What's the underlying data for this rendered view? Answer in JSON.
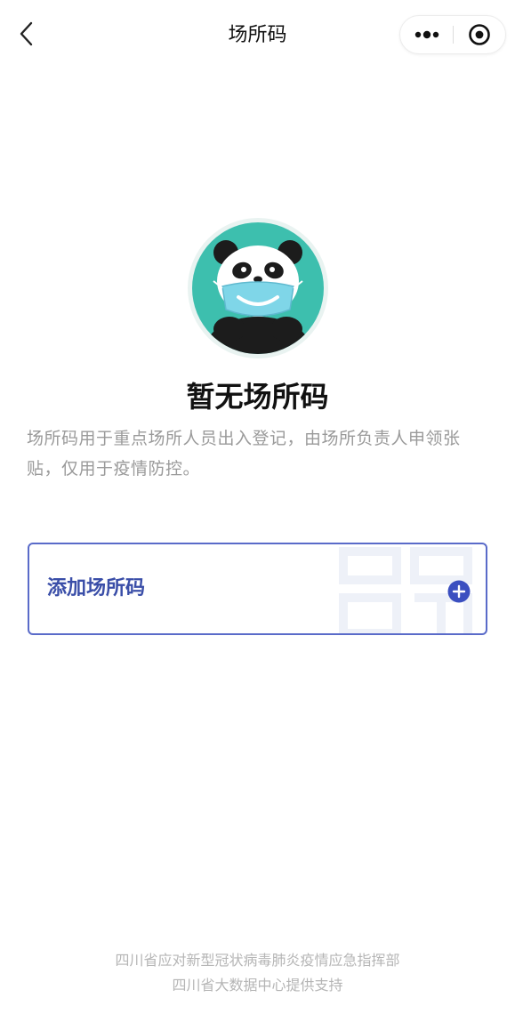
{
  "navbar": {
    "title": "场所码",
    "back_icon": "chevron-left-icon",
    "more_icon": "more-dots-icon",
    "close_icon": "target-close-icon"
  },
  "empty_state": {
    "mascot_icon": "masked-panda-icon",
    "title": "暂无场所码",
    "description": "场所码用于重点场所人员出入登记，由场所负责人申领张贴，仅用于疫情防控。"
  },
  "add_card": {
    "label": "添加场所码",
    "icon": "plus-circle-icon",
    "accent_color": "#3a4ea8"
  },
  "footer": {
    "line1": "四川省应对新型冠状病毒肺炎疫情应急指挥部",
    "line2": "四川省大数据中心提供支持"
  },
  "colors": {
    "mascot_bg": "#3dbfae",
    "border_accent": "#5a6bc9"
  }
}
